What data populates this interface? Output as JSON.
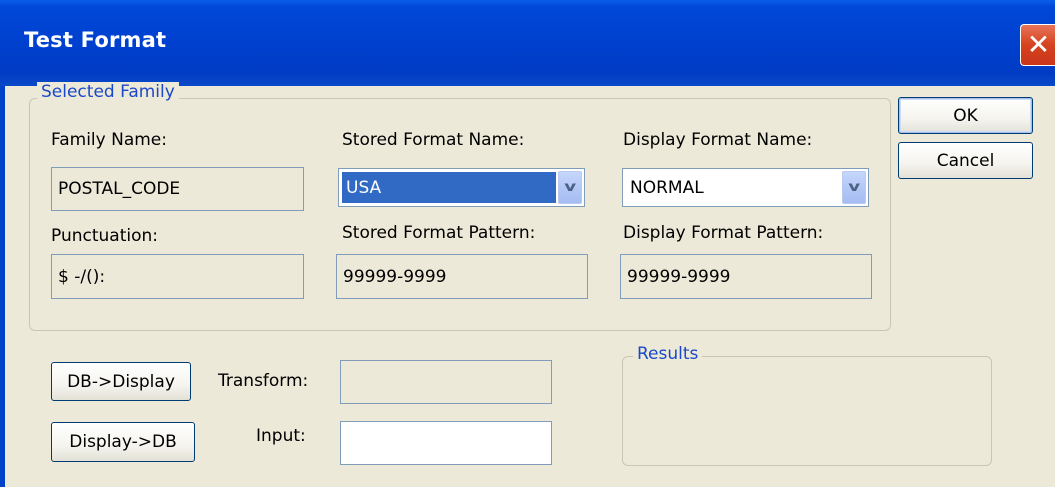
{
  "window": {
    "title": "Test Format",
    "close_glyph": "✕"
  },
  "selected_family": {
    "group_label": "Selected Family",
    "family_name_label": "Family Name:",
    "family_name_value": "POSTAL_CODE",
    "stored_format_name_label": "Stored Format Name:",
    "stored_format_name_value": "USA",
    "display_format_name_label": "Display Format Name:",
    "display_format_name_value": "NORMAL",
    "punctuation_label": "Punctuation:",
    "punctuation_value": "$ -/():",
    "stored_format_pattern_label": "Stored Format Pattern:",
    "stored_format_pattern_value": "99999-9999",
    "display_format_pattern_label": "Display Format Pattern:",
    "display_format_pattern_value": "99999-9999"
  },
  "buttons": {
    "ok": "OK",
    "cancel": "Cancel",
    "db_to_display": "DB->Display",
    "display_to_db": "Display->DB"
  },
  "transform": {
    "label": "Transform:",
    "value": ""
  },
  "input": {
    "label": "Input:",
    "value": ""
  },
  "results": {
    "group_label": "Results"
  },
  "icons": {
    "dropdown_arrow": "chevron-down-icon",
    "close": "close-icon"
  },
  "colors": {
    "titlebar": "#0040cf",
    "dialog_bg": "#ece9d8",
    "group_label": "#1a48c9",
    "selection": "#316ac5"
  }
}
